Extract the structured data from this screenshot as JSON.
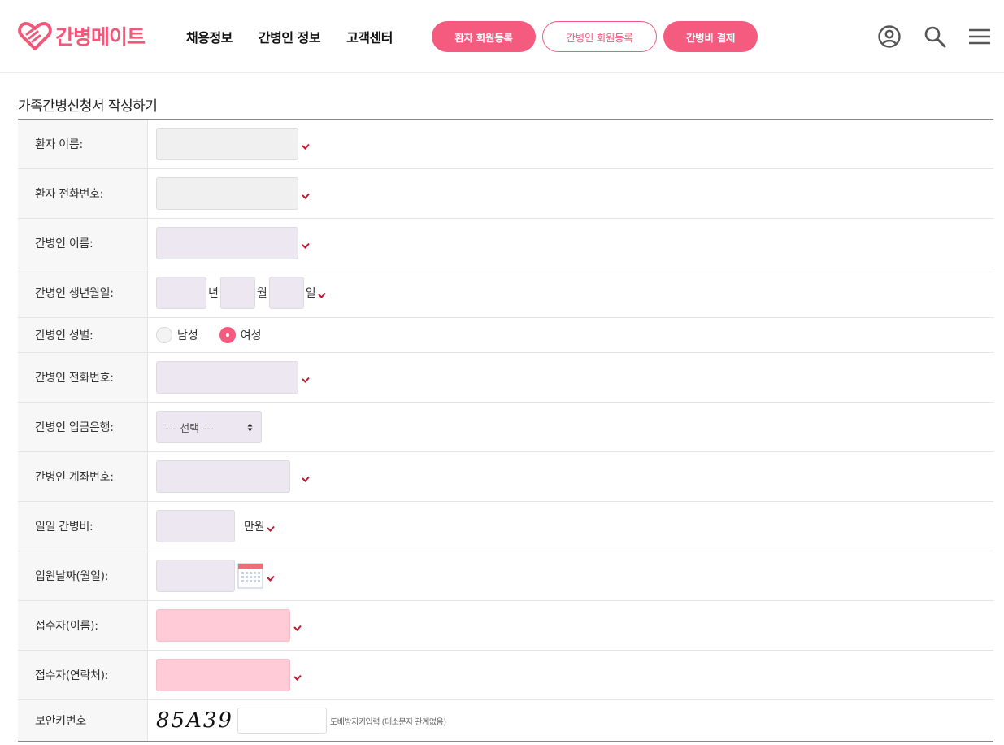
{
  "brand": {
    "name": "간병메이트",
    "accent": "#f45b7f"
  },
  "nav": [
    {
      "label": "채용정보"
    },
    {
      "label": "간병인 정보"
    },
    {
      "label": "고객센터"
    }
  ],
  "actions": {
    "patient_register": "환자 회원등록",
    "caregiver_register": "간병인 회원등록",
    "payment": "간병비 결제"
  },
  "header_icons": [
    "user-icon",
    "search-icon",
    "menu-icon"
  ],
  "form": {
    "title": "가족간병신청서 작성하기",
    "patient_name": {
      "label": "환자 이름:",
      "value": ""
    },
    "patient_phone": {
      "label": "환자 전화번호:",
      "value": ""
    },
    "caregiver_name": {
      "label": "간병인 이름:",
      "value": ""
    },
    "caregiver_birth": {
      "label": "간병인 생년월일:",
      "year_unit": "년",
      "month_unit": "월",
      "day_unit": "일"
    },
    "caregiver_gender": {
      "label": "간병인 성별:",
      "options": [
        "남성",
        "여성"
      ],
      "selected": "여성"
    },
    "caregiver_phone": {
      "label": "간병인 전화번호:",
      "value": ""
    },
    "caregiver_bank": {
      "label": "간병인 입금은행:",
      "selected": "--- 선택 ---"
    },
    "caregiver_account": {
      "label": "간병인 계좌번호:",
      "value": ""
    },
    "daily_fee": {
      "label": "일일 간병비:",
      "unit": "만원"
    },
    "admission_date": {
      "label": "입원날짜(월일):",
      "value": ""
    },
    "receiver_name": {
      "label": "접수자(이름):",
      "value": ""
    },
    "receiver_contact": {
      "label": "접수자(연락처):",
      "value": ""
    },
    "security": {
      "label": "보안키번호",
      "captcha": "85A39",
      "hint": "도배방지키입력 (대소문자 관계없음)"
    }
  }
}
